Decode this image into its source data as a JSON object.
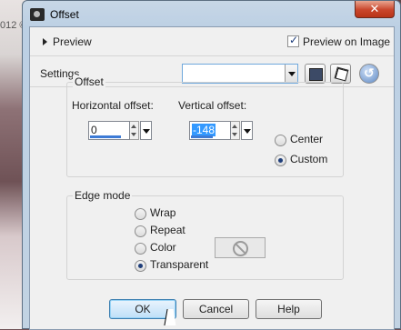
{
  "window": {
    "title": "Offset",
    "close_glyph": "✕"
  },
  "background": {
    "text": "012 ©"
  },
  "preview": {
    "label": "Preview",
    "on_image_label": "Preview on Image",
    "on_image_checked": true
  },
  "settings": {
    "label": "Settings",
    "value": ""
  },
  "offset": {
    "group_title": "Offset",
    "horizontal": {
      "label": "Horizontal offset:",
      "value": "0"
    },
    "vertical": {
      "label": "Vertical offset:",
      "value": "-148"
    },
    "modes": [
      {
        "label": "Center",
        "selected": false
      },
      {
        "label": "Custom",
        "selected": true
      }
    ]
  },
  "edge_mode": {
    "group_title": "Edge mode",
    "options": [
      {
        "label": "Wrap",
        "selected": false
      },
      {
        "label": "Repeat",
        "selected": false
      },
      {
        "label": "Color",
        "selected": false
      },
      {
        "label": "Transparent",
        "selected": true
      }
    ]
  },
  "buttons": {
    "ok": "OK",
    "cancel": "Cancel",
    "help": "Help"
  },
  "icons": [
    "save-icon",
    "randomize-dice-icon",
    "reset-icon",
    "no-entry-icon",
    "mouse-cursor-icon"
  ]
}
